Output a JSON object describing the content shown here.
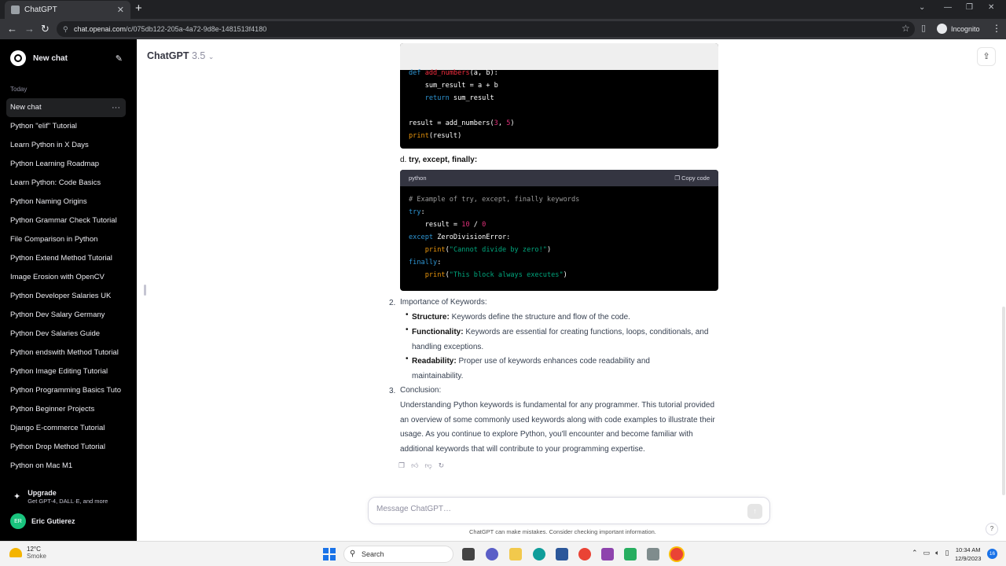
{
  "browser": {
    "tab_title": "ChatGPT",
    "new_tab": "+",
    "url_host": "chat.openai.com",
    "url_path": "/c/075db122-205a-4a72-9d8e-1481513f4180",
    "incognito_label": "Incognito"
  },
  "sidebar": {
    "new_chat_label": "New chat",
    "section_today": "Today",
    "items": [
      "New chat",
      "Python \"elif\" Tutorial",
      "Learn Python in X Days",
      "Python Learning Roadmap",
      "Learn Python: Code Basics",
      "Python Naming Origins",
      "Python Grammar Check Tutorial",
      "File Comparison in Python",
      "Python Extend Method Tutorial",
      "Image Erosion with OpenCV",
      "Python Developer Salaries UK",
      "Python Dev Salary Germany",
      "Python Dev Salaries Guide",
      "Python endswith Method Tutorial",
      "Python Image Editing Tutorial",
      "Python Programming Basics Tuto",
      "Python Beginner Projects",
      "Django E-commerce Tutorial",
      "Python Drop Method Tutorial",
      "Python on Mac M1"
    ],
    "upgrade_title": "Upgrade",
    "upgrade_sub": "Get GPT-4, DALL·E, and more",
    "user_initials": "ER",
    "user_name": "Eric Gutierez"
  },
  "header": {
    "model": "ChatGPT",
    "version": "3.5"
  },
  "code1": {
    "lines": [
      [
        {
          "t": "def ",
          "c": "kw"
        },
        {
          "t": "add_numbers",
          "c": "fn"
        },
        {
          "t": "(a, b):",
          "c": ""
        }
      ],
      [
        {
          "t": "    sum_result = a + b",
          "c": ""
        }
      ],
      [
        {
          "t": "    ",
          "c": ""
        },
        {
          "t": "return",
          "c": "kw"
        },
        {
          "t": " sum_result",
          "c": ""
        }
      ],
      [
        {
          "t": "",
          "c": ""
        }
      ],
      [
        {
          "t": "result = add_numbers(",
          "c": ""
        },
        {
          "t": "3",
          "c": "num"
        },
        {
          "t": ", ",
          "c": ""
        },
        {
          "t": "5",
          "c": "num"
        },
        {
          "t": ")",
          "c": ""
        }
      ],
      [
        {
          "t": "print",
          "c": "orng"
        },
        {
          "t": "(result)",
          "c": ""
        }
      ]
    ]
  },
  "section_d": {
    "prefix": "d. ",
    "title": "try, except, finally:"
  },
  "code2": {
    "lang": "python",
    "copy_label": "Copy code",
    "lines": [
      [
        {
          "t": "# Example of try, except, finally keywords",
          "c": "com"
        }
      ],
      [
        {
          "t": "try",
          "c": "kw"
        },
        {
          "t": ":",
          "c": ""
        }
      ],
      [
        {
          "t": "    result = ",
          "c": ""
        },
        {
          "t": "10",
          "c": "num"
        },
        {
          "t": " / ",
          "c": ""
        },
        {
          "t": "0",
          "c": "num"
        }
      ],
      [
        {
          "t": "except",
          "c": "kw"
        },
        {
          "t": " ZeroDivisionError:",
          "c": ""
        }
      ],
      [
        {
          "t": "    ",
          "c": ""
        },
        {
          "t": "print",
          "c": "orng"
        },
        {
          "t": "(",
          "c": ""
        },
        {
          "t": "\"Cannot divide by zero!\"",
          "c": "str"
        },
        {
          "t": ")",
          "c": ""
        }
      ],
      [
        {
          "t": "finally",
          "c": "kw"
        },
        {
          "t": ":",
          "c": ""
        }
      ],
      [
        {
          "t": "    ",
          "c": ""
        },
        {
          "t": "print",
          "c": "orng"
        },
        {
          "t": "(",
          "c": ""
        },
        {
          "t": "\"This block always executes\"",
          "c": "str"
        },
        {
          "t": ")",
          "c": ""
        }
      ]
    ]
  },
  "importance": {
    "num": "2.",
    "title": "Importance of Keywords:",
    "bullets": [
      {
        "label": "Structure:",
        "text": " Keywords define the structure and flow of the code."
      },
      {
        "label": "Functionality:",
        "text": " Keywords are essential for creating functions, loops, conditionals, and handling exceptions."
      },
      {
        "label": "Readability:",
        "text": " Proper use of keywords enhances code readability and maintainability."
      }
    ]
  },
  "conclusion": {
    "num": "3.",
    "title": "Conclusion:",
    "text": "Understanding Python keywords is fundamental for any programmer. This tutorial provided an overview of some commonly used keywords along with code examples to illustrate their usage. As you continue to explore Python, you'll encounter and become familiar with additional keywords that will contribute to your programming expertise."
  },
  "composer": {
    "placeholder": "Message ChatGPT…",
    "disclaimer": "ChatGPT can make mistakes. Consider checking important information."
  },
  "taskbar": {
    "temp": "12°C",
    "condition": "Smoke",
    "search_label": "Search",
    "time": "10:34 AM",
    "date": "12/9/2023",
    "notif_count": "16"
  }
}
